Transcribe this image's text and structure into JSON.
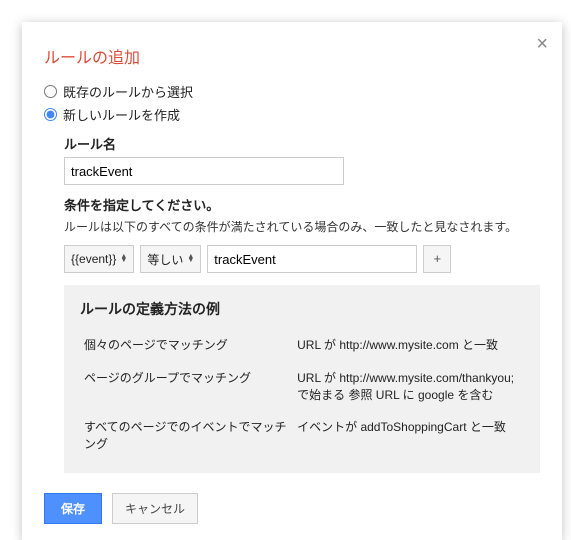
{
  "dialog": {
    "title": "ルールの追加",
    "close": "×",
    "radio_existing": "既存のルールから選択",
    "radio_new": "新しいルールを作成",
    "radio_selected": "new",
    "rule_name_label": "ルール名",
    "rule_name_value": "trackEvent",
    "conditions_label": "条件を指定してください。",
    "conditions_help": "ルールは以下のすべての条件が満たされている場合のみ、一致したと見なされます。",
    "cond_macro": "{{event}}",
    "cond_operator": "等しい",
    "cond_value": "trackEvent",
    "add_btn": "+",
    "examples": {
      "heading": "ルールの定義方法の例",
      "rows": [
        {
          "left": "個々のページでマッチング",
          "right": "URL が http://www.mysite.com と一致"
        },
        {
          "left": "ページのグループでマッチング",
          "right": "URL が http://www.mysite.com/thankyou; で始まる\n参照 URL に google を含む"
        },
        {
          "left": "すべてのページでのイベントでマッチング",
          "right": "イベントが addToShoppingCart と一致"
        }
      ]
    },
    "save_label": "保存",
    "cancel_label": "キャンセル"
  }
}
